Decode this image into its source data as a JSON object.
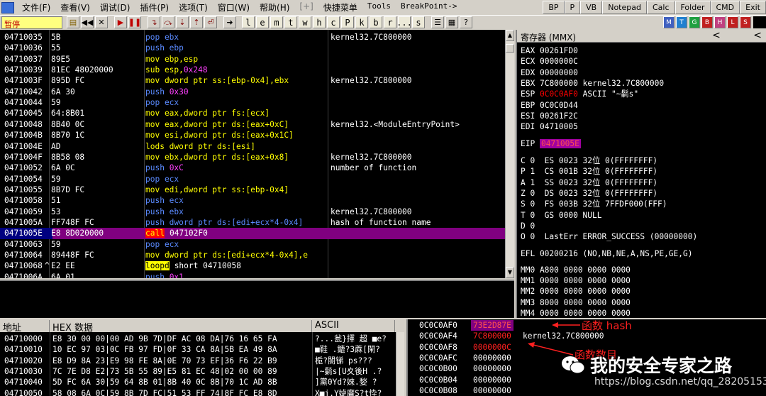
{
  "menu": {
    "items": [
      "文件(F)",
      "查看(V)",
      "调试(D)",
      "插件(P)",
      "选项(T)",
      "窗口(W)",
      "帮助(H)",
      "[+]",
      "快捷菜单",
      "Tools",
      "BreakPoint->"
    ],
    "quick_buttons": [
      "BP",
      "P",
      "VB",
      "Notepad",
      "Calc",
      "Folder",
      "CMD",
      "Exit"
    ]
  },
  "toolbar": {
    "status": "暂停",
    "letter_buttons": [
      "l",
      "e",
      "m",
      "t",
      "w",
      "h",
      "c",
      "P",
      "k",
      "b",
      "r",
      "...",
      "s"
    ],
    "colored_buttons": [
      "M",
      "T",
      "G",
      "B",
      "H",
      "L",
      "S"
    ]
  },
  "disasm": [
    {
      "addr": "04710035",
      "hex": "5B",
      "mn": [
        [
          "pop",
          "blue"
        ],
        [
          " ebx",
          "blue"
        ]
      ],
      "style": "blue",
      "text": "pop ebx",
      "comment": "kernel32.7C800000"
    },
    {
      "addr": "04710036",
      "hex": "55",
      "style": "blue",
      "text": "push ebp",
      "comment": ""
    },
    {
      "addr": "04710037",
      "hex": "89E5",
      "style": "yellow",
      "text": "mov ebp,esp",
      "comment": ""
    },
    {
      "addr": "04710039",
      "hex": "81EC 48020000",
      "style": "yellow",
      "text": "sub esp,",
      "num": "0x248",
      "comment": ""
    },
    {
      "addr": "0471003F",
      "hex": "895D FC",
      "style": "yellow",
      "text": "mov dword ptr ss:[ebp-0x4],ebx",
      "comment": "kernel32.7C800000"
    },
    {
      "addr": "04710042",
      "hex": "6A 30",
      "style": "blue",
      "text": "push ",
      "num": "0x30",
      "comment": ""
    },
    {
      "addr": "04710044",
      "hex": "59",
      "style": "blue",
      "text": "pop ecx",
      "comment": ""
    },
    {
      "addr": "04710045",
      "hex": "64:8B01",
      "style": "yellow",
      "text": "mov eax,dword ptr fs:[ecx]",
      "comment": ""
    },
    {
      "addr": "04710048",
      "hex": "8B40 0C",
      "style": "yellow",
      "text": "mov eax,dword ptr ds:[eax+0xC]",
      "comment": "kernel32.<ModuleEntryPoint>"
    },
    {
      "addr": "0471004B",
      "hex": "8B70 1C",
      "style": "yellow",
      "text": "mov esi,dword ptr ds:[eax+0x1C]",
      "comment": ""
    },
    {
      "addr": "0471004E",
      "hex": "AD",
      "style": "yellow",
      "text": "lods dword ptr ds:[esi]",
      "comment": ""
    },
    {
      "addr": "0471004F",
      "hex": "8B58 08",
      "style": "yellow",
      "text": "mov ebx,dword ptr ds:[eax+0x8]",
      "comment": "kernel32.7C800000"
    },
    {
      "addr": "04710052",
      "hex": "6A 0C",
      "style": "blue",
      "text": "push ",
      "num": "0xC",
      "comment": "number of function"
    },
    {
      "addr": "04710054",
      "hex": "59",
      "style": "blue",
      "text": "pop ecx",
      "comment": ""
    },
    {
      "addr": "04710055",
      "hex": "8B7D FC",
      "style": "yellow",
      "text": "mov edi,dword ptr ss:[ebp-0x4]",
      "comment": ""
    },
    {
      "addr": "04710058",
      "hex": "51",
      "style": "blue",
      "text": "push ecx",
      "comment": ""
    },
    {
      "addr": "04710059",
      "hex": "53",
      "style": "blue",
      "text": "push ebx",
      "comment": "kernel32.7C800000"
    },
    {
      "addr": "0471005A",
      "hex": "FF748F FC",
      "style": "blue",
      "text": "push dword ptr ds:[edi+ecx*4-0x4]",
      "comment": "hash of function name"
    },
    {
      "addr": "0471005E",
      "hex": "E8 8D020000",
      "style": "call",
      "text": "call",
      "target": "047102F0",
      "comment": "",
      "selected": true
    },
    {
      "addr": "04710063",
      "hex": "59",
      "style": "blue",
      "text": "pop ecx",
      "comment": ""
    },
    {
      "addr": "04710064",
      "hex": "89448F FC",
      "style": "yellow",
      "text": "mov dword ptr ds:[edi+ecx*4-0x4],e",
      "comment": ""
    },
    {
      "addr": "04710068",
      "hex": "E2 EE",
      "marker": "^",
      "style": "loop",
      "text": "loopd",
      "target": "short 04710058",
      "comment": ""
    },
    {
      "addr": "0471006A",
      "hex": "6A 01",
      "style": "blue",
      "text": "push ",
      "num": "0x1",
      "comment": ""
    }
  ],
  "registers": {
    "title": "寄存器 (MMX)",
    "nav": [
      "<",
      "<"
    ],
    "gp": [
      {
        "name": "EAX",
        "value": "00261FD0",
        "note": ""
      },
      {
        "name": "ECX",
        "value": "0000000C",
        "note": ""
      },
      {
        "name": "EDX",
        "value": "00000000",
        "note": ""
      },
      {
        "name": "EBX",
        "value": "7C800000",
        "note": "kernel32.7C800000"
      },
      {
        "name": "ESP",
        "value": "0C0C0AF0",
        "note": "ASCII \"~鬎s\"",
        "changed": true
      },
      {
        "name": "EBP",
        "value": "0C0C0D44",
        "note": ""
      },
      {
        "name": "ESI",
        "value": "00261F2C",
        "note": ""
      },
      {
        "name": "EDI",
        "value": "04710005",
        "note": ""
      }
    ],
    "eip": {
      "name": "EIP",
      "value": "0471005E"
    },
    "flags": [
      "C 0  ES 0023 32位 0(FFFFFFFF)",
      "P 1  CS 001B 32位 0(FFFFFFFF)",
      "A 1  SS 0023 32位 0(FFFFFFFF)",
      "Z 0  DS 0023 32位 0(FFFFFFFF)",
      "S 0  FS 003B 32位 7FFDF000(FFF)",
      "T 0  GS 0000 NULL",
      "D 0",
      "O 0  LastErr ERROR_SUCCESS (00000000)"
    ],
    "efl": "EFL 00200216 (NO,NB,NE,A,NS,PE,GE,G)",
    "mmx": [
      "MM0 A800 0000 0000 0000",
      "MM1 0000 0000 0000 0000",
      "MM2 0000 0000 0000 0000",
      "MM3 8000 0000 0000 0000",
      "MM4 0000 0000 0000 0000"
    ]
  },
  "dump": {
    "headers": [
      "地址",
      "HEX 数据",
      "ASCII"
    ],
    "rows": [
      {
        "addr": "04710000",
        "hex": "E8 30 00 00|00 AD 9B 7D|DF AC 08 DA|76 16 65 FA",
        "ascii": "?...瓮}擇 超 ■e?"
      },
      {
        "addr": "04710010",
        "hex": "10 EC 97 03|0C FB 97 FD|0F 33 CA 8A|5B EA 49 8A",
        "ascii": "■鞋 .鏕?3蔴[閑?"
      },
      {
        "addr": "04710020",
        "hex": "E8 D9 8A 23|E9 98 FE 8A|0E 70 73 EF|36 F6 22 B9",
        "ascii": "栀?閿锑 ps??? "
      },
      {
        "addr": "04710030",
        "hex": "7C 7E D8 E2|73 5B 55 89|E5 81 EC 48|02 00 00 89",
        "ascii": "|~鬎s[U夊後H .?"
      },
      {
        "addr": "04710040",
        "hex": "5D FC 6A 30|59 64 8B 01|8B 40 0C 8B|70 1C AD 8B",
        "ascii": "]黨0Yd?婡.媝 ?"
      },
      {
        "addr": "04710050",
        "hex": "58 08 6A 0C|59 8B 7D FC|51 53 FF 74|8F FC E8 8D",
        "ascii": "X■j.Y媫黂S?t忰?"
      }
    ]
  },
  "stack": {
    "rows": [
      {
        "addr": "0C0C0AF0",
        "value": "73E2D87E",
        "note": "",
        "selected": true
      },
      {
        "addr": "0C0C0AF4",
        "value": "7C800000",
        "note": "kernel32.7C800000"
      },
      {
        "addr": "0C0C0AF8",
        "value": "0000000C",
        "note": ""
      },
      {
        "addr": "0C0C0AFC",
        "value": "00000000",
        "note": ""
      },
      {
        "addr": "0C0C0B00",
        "value": "00000000",
        "note": ""
      },
      {
        "addr": "0C0C0B04",
        "value": "00000000",
        "note": ""
      },
      {
        "addr": "0C0C0B08",
        "value": "00000000",
        "note": ""
      }
    ]
  },
  "annotations": {
    "hash_label": "函数 hash",
    "count_label": "函数数目"
  },
  "watermark": {
    "brand": "我的安全专家之路",
    "url": "https://blog.csdn.net/qq_28205153"
  },
  "colors": {
    "pane_bg": "#000000",
    "blue_mnemonic": "#5a8aff",
    "yellow_mnemonic": "#ffff00",
    "call_bg": "#ff0000",
    "selected_row": "#800080",
    "annotation_red": "#ff2020"
  }
}
